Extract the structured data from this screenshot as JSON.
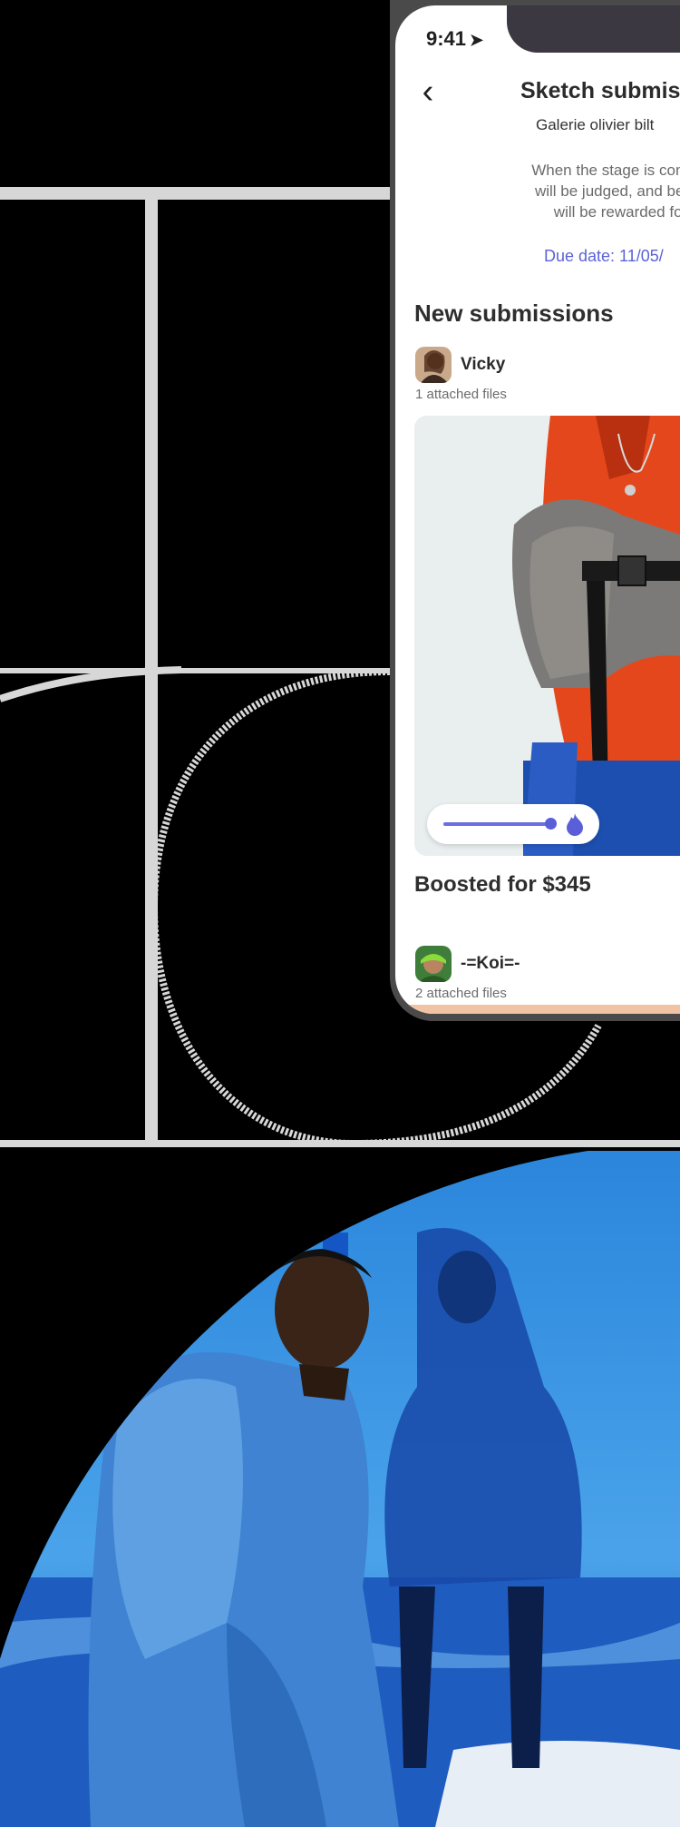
{
  "status_bar": {
    "time": "9:41",
    "location_icon": "location-arrow-icon"
  },
  "header": {
    "back_icon": "chevron-left-icon",
    "title": "Sketch submis",
    "subtitle": "Galerie olivier bilt"
  },
  "description": "When the stage is complete\nwill be judged, and best of t\nwill be rewarded for their",
  "due_date": "Due date: 11/05/",
  "section_title": "New submissions",
  "submissions": [
    {
      "user": "Vicky",
      "files": "1 attached files",
      "boost_level": 0.85,
      "boost_icon": "flame-icon",
      "boost_text": "Boosted for $345"
    },
    {
      "user": "-=Koi=-",
      "files": "2 attached files"
    }
  ],
  "colors": {
    "accent": "#5a63d8",
    "background": "#000000",
    "grid": "#d7d7d7"
  }
}
